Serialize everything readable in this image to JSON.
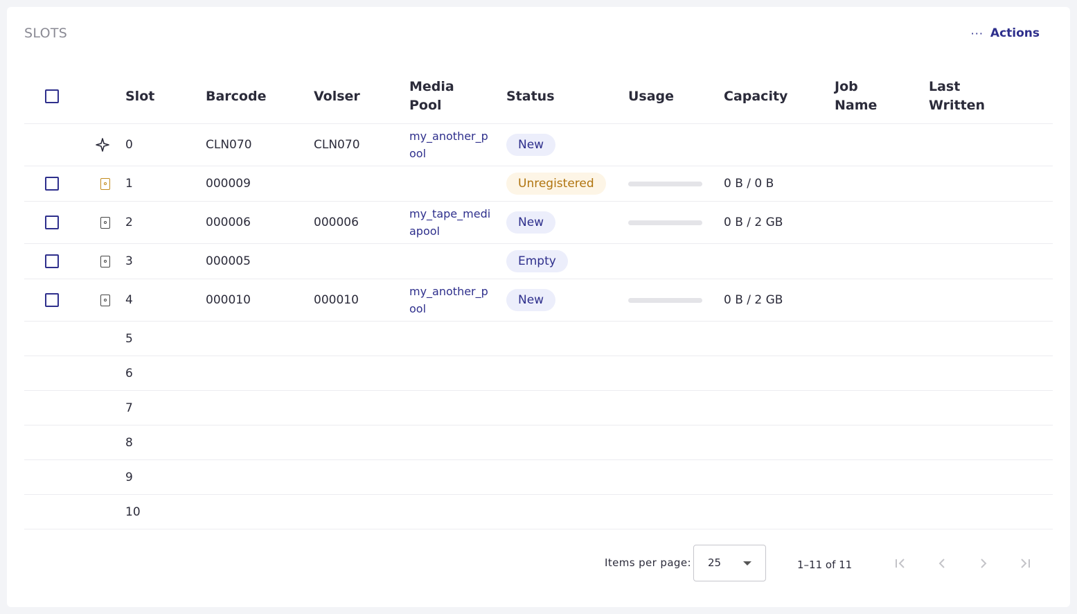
{
  "card": {
    "title": "SLOTS",
    "actions_icon": "more-horizontal-icon",
    "actions_label": "Actions"
  },
  "table": {
    "columns": [
      "Slot",
      "Barcode",
      "Volser",
      "Media Pool",
      "Status",
      "Usage",
      "Capacity",
      "Job Name",
      "Last Written"
    ],
    "columns_wrapped": {
      "media_pool": [
        "Media",
        "Pool"
      ],
      "job_name": [
        "Job",
        "Name"
      ],
      "last_written": [
        "Last",
        "Written"
      ]
    },
    "rows": [
      {
        "slot": "0",
        "icon": "cleaning-star-icon",
        "has_checkbox": false,
        "barcode": "CLN070",
        "volser": "CLN070",
        "pool": "my_another_pool",
        "status": "New",
        "status_tone": "info",
        "usage": null,
        "capacity": ""
      },
      {
        "slot": "1",
        "icon": "tape-warning-icon",
        "has_checkbox": true,
        "barcode": "000009",
        "volser": "",
        "pool": "",
        "status": "Unregistered",
        "status_tone": "warn",
        "usage": 0,
        "capacity": "0 B / 0 B"
      },
      {
        "slot": "2",
        "icon": "tape-icon",
        "has_checkbox": true,
        "barcode": "000006",
        "volser": "000006",
        "pool": "my_tape_mediapool",
        "status": "New",
        "status_tone": "info",
        "usage": 0,
        "capacity": "0 B / 2 GB"
      },
      {
        "slot": "3",
        "icon": "tape-icon",
        "has_checkbox": true,
        "barcode": "000005",
        "volser": "",
        "pool": "",
        "status": "Empty",
        "status_tone": "info",
        "usage": null,
        "capacity": ""
      },
      {
        "slot": "4",
        "icon": "tape-icon",
        "has_checkbox": true,
        "barcode": "000010",
        "volser": "000010",
        "pool": "my_another_pool",
        "status": "New",
        "status_tone": "info",
        "usage": 0,
        "capacity": "0 B / 2 GB"
      },
      {
        "slot": "5"
      },
      {
        "slot": "6"
      },
      {
        "slot": "7"
      },
      {
        "slot": "8"
      },
      {
        "slot": "9"
      },
      {
        "slot": "10"
      }
    ]
  },
  "paginator": {
    "items_per_page_label": "Items per page:",
    "items_per_page_value": "25",
    "range_label": "1–11 of 11",
    "buttons": [
      "first-page-icon",
      "previous-page-icon",
      "next-page-icon",
      "last-page-icon"
    ]
  },
  "colors": {
    "accent": "#2e2f8c",
    "warn": "#b0740f",
    "badge_info_bg": "#eceefb",
    "badge_warn_bg": "#fdf5e6"
  }
}
